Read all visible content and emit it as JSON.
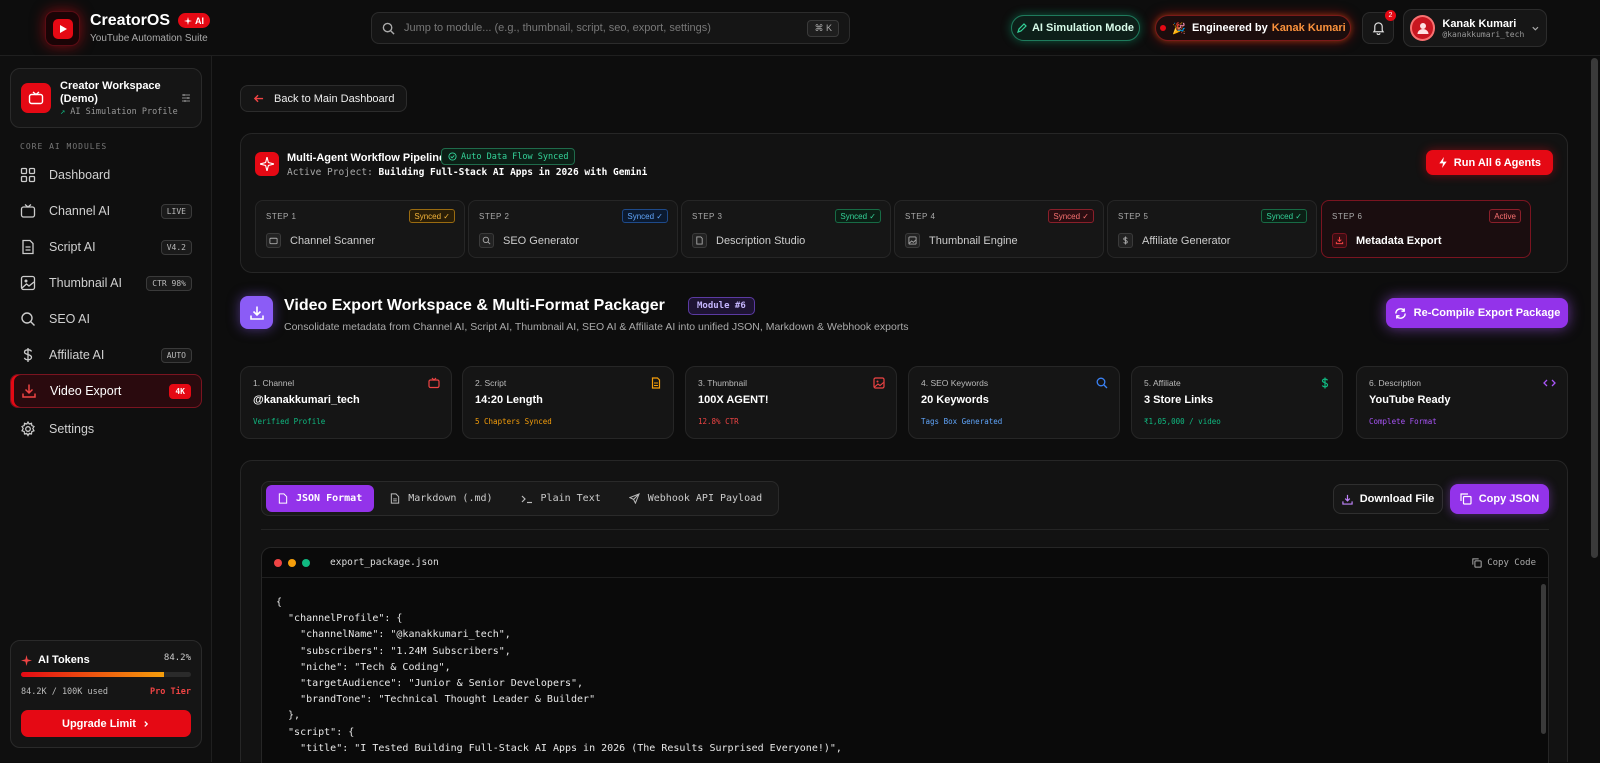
{
  "brand": {
    "name": "CreatorOS",
    "badge": "AI",
    "subtitle": "YouTube Automation Suite"
  },
  "search": {
    "placeholder": "Jump to module... (e.g., thumbnail, script, seo, export, settings)",
    "shortcut": "⌘ K"
  },
  "header": {
    "sim_mode": "AI Simulation Mode",
    "engineered_prefix": "Engineered by",
    "engineered_name": "Kanak Kumari",
    "notifications_count": "2",
    "user": {
      "name": "Kanak Kumari",
      "handle": "@kanakkumari_tech"
    }
  },
  "sidebar": {
    "workspace": {
      "title": "Creator Workspace (Demo)",
      "subtitle": "AI Simulation Profile"
    },
    "section_label": "CORE AI MODULES",
    "items": [
      {
        "label": "Dashboard",
        "tag": "",
        "icon": "grid-icon"
      },
      {
        "label": "Channel AI",
        "tag": "LIVE",
        "icon": "tv-icon"
      },
      {
        "label": "Script AI",
        "tag": "V4.2",
        "icon": "document-icon"
      },
      {
        "label": "Thumbnail AI",
        "tag": "CTR 98%",
        "icon": "image-icon"
      },
      {
        "label": "SEO AI",
        "tag": "",
        "icon": "search-icon"
      },
      {
        "label": "Affiliate AI",
        "tag": "AUTO",
        "icon": "dollar-icon"
      },
      {
        "label": "Video Export",
        "tag": "4K",
        "icon": "download-icon"
      },
      {
        "label": "Settings",
        "tag": "",
        "icon": "gear-icon"
      }
    ],
    "tokens": {
      "title": "AI Tokens",
      "percent_label": "84.2%",
      "percent": 84.2,
      "used": "84.2K / 100K used",
      "tier": "Pro Tier",
      "upgrade": "Upgrade Limit"
    }
  },
  "main": {
    "back_label": "Back to Main Dashboard",
    "pipeline": {
      "title": "Multi-Agent Workflow Pipeline",
      "flow_badge": "Auto Data Flow Synced",
      "project_prefix": "Active Project:",
      "project_name": "Building Full-Stack AI Apps in 2026 with Gemini",
      "run_all": "Run All 6 Agents",
      "steps": [
        {
          "num": "STEP 1",
          "badge": "Synced ✓",
          "label": "Channel Scanner"
        },
        {
          "num": "STEP 2",
          "badge": "Synced ✓",
          "label": "SEO Generator"
        },
        {
          "num": "STEP 3",
          "badge": "Synced ✓",
          "label": "Description Studio"
        },
        {
          "num": "STEP 4",
          "badge": "Synced ✓",
          "label": "Thumbnail Engine"
        },
        {
          "num": "STEP 5",
          "badge": "Synced ✓",
          "label": "Affiliate Generator"
        },
        {
          "num": "STEP 6",
          "badge": "Active",
          "label": "Metadata Export"
        }
      ]
    },
    "module": {
      "title": "Video Export Workspace & Multi-Format Packager",
      "badge": "Module #6",
      "subtitle": "Consolidate metadata from Channel AI, Script AI, Thumbnail AI, SEO AI & Affiliate AI into unified JSON, Markdown & Webhook exports",
      "recompile": "Re-Compile Export Package"
    },
    "cards": [
      {
        "label": "1. Channel",
        "value": "@kanakkumari_tech",
        "sub": "Verified Profile",
        "color": "#10b981"
      },
      {
        "label": "2. Script",
        "value": "14:20 Length",
        "sub": "5 Chapters Synced",
        "color": "#f59e0b"
      },
      {
        "label": "3. Thumbnail",
        "value": "100X AGENT!",
        "sub": "12.8% CTR",
        "color": "#ef4444"
      },
      {
        "label": "4. SEO Keywords",
        "value": "20 Keywords",
        "sub": "Tags Box Generated",
        "color": "#3b82f6"
      },
      {
        "label": "5. Affiliate",
        "value": "3 Store Links",
        "sub": "₹1,05,000 / video",
        "color": "#10b981"
      },
      {
        "label": "6. Description",
        "value": "YouTube Ready",
        "sub": "Complete Format",
        "color": "#a855f7"
      }
    ],
    "export": {
      "tabs": [
        "JSON Format",
        "Markdown (.md)",
        "Plain Text",
        "Webhook API Payload"
      ],
      "active_tab": 0,
      "download": "Download File",
      "copy": "Copy JSON",
      "filename": "export_package.json",
      "copy_code": "Copy Code",
      "code_lines": [
        "{",
        "  \"channelProfile\": {",
        "    \"channelName\": \"@kanakkumari_tech\",",
        "    \"subscribers\": \"1.24M Subscribers\",",
        "    \"niche\": \"Tech & Coding\",",
        "    \"targetAudience\": \"Junior & Senior Developers\",",
        "    \"brandTone\": \"Technical Thought Leader & Builder\"",
        "  },",
        "  \"script\": {",
        "    \"title\": \"I Tested Building Full-Stack AI Apps in 2026 (The Results Surprised Everyone!)\","
      ]
    }
  },
  "colors": {
    "accent": "#e50914",
    "purple": "#9333ea",
    "green": "#10b981"
  }
}
